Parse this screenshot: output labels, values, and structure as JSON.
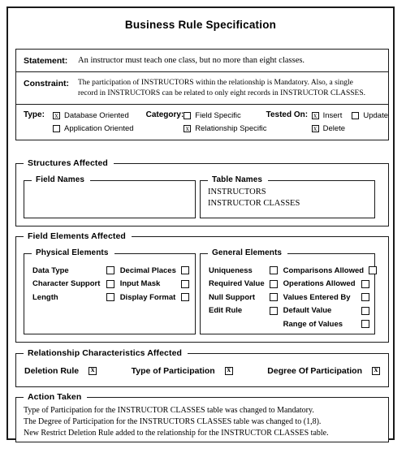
{
  "document": {
    "title": "Business Rule Specification"
  },
  "header": {
    "statement": {
      "label": "Statement:",
      "text": "An instructor must teach one class, but no more than eight classes."
    },
    "constraint": {
      "label": "Constraint:",
      "line1": "The participation of INSTRUCTORS within the relationship is Mandatory. Also, a single",
      "line2": "record in INSTRUCTORS can be related to only eight records in INSTRUCTOR CLASSES."
    }
  },
  "classification": {
    "type": {
      "label": "Type:",
      "options": [
        {
          "label": "Database Oriented",
          "checked": true
        },
        {
          "label": "Application Oriented",
          "checked": false
        }
      ]
    },
    "category": {
      "label": "Category:",
      "options": [
        {
          "label": "Field Specific",
          "checked": false
        },
        {
          "label": "Relationship Specific",
          "checked": true
        }
      ]
    },
    "tested_on": {
      "label": "Tested On:",
      "options": [
        {
          "label": "Insert",
          "checked": true
        },
        {
          "label": "Update",
          "checked": false
        },
        {
          "label": "Delete",
          "checked": true
        }
      ]
    }
  },
  "structures_affected": {
    "legend": "Structures Affected",
    "field_names": {
      "legend": "Field Names",
      "items": []
    },
    "table_names": {
      "legend": "Table Names",
      "items": [
        "INSTRUCTORS",
        "INSTRUCTOR CLASSES"
      ]
    }
  },
  "field_elements_affected": {
    "legend": "Field Elements Affected",
    "physical_elements": {
      "legend": "Physical Elements",
      "column1": [
        {
          "label": "Data Type",
          "checked": false
        },
        {
          "label": "Character Support",
          "checked": false
        },
        {
          "label": "Length",
          "checked": false
        }
      ],
      "column2": [
        {
          "label": "Decimal Places",
          "checked": false
        },
        {
          "label": "Input Mask",
          "checked": false
        },
        {
          "label": "Display Format",
          "checked": false
        }
      ]
    },
    "general_elements": {
      "legend": "General Elements",
      "column1": [
        {
          "label": "Uniqueness",
          "checked": false
        },
        {
          "label": "Required Value",
          "checked": false
        },
        {
          "label": "Null Support",
          "checked": false
        },
        {
          "label": "Edit Rule",
          "checked": false
        }
      ],
      "column2": [
        {
          "label": "Comparisons Allowed",
          "checked": false
        },
        {
          "label": "Operations Allowed",
          "checked": false
        },
        {
          "label": "Values Entered By",
          "checked": false
        },
        {
          "label": "Default Value",
          "checked": false
        },
        {
          "label": "Range of Values",
          "checked": false
        }
      ]
    }
  },
  "relationship_characteristics_affected": {
    "legend": "Relationship Characteristics Affected",
    "items": [
      {
        "label": "Deletion Rule",
        "checked": true
      },
      {
        "label": "Type of Participation",
        "checked": true
      },
      {
        "label": "Degree Of Participation",
        "checked": true
      }
    ]
  },
  "action_taken": {
    "legend": "Action Taken",
    "lines": [
      "Type of Participation for the INSTRUCTOR CLASSES table was changed to Mandatory.",
      "The Degree of Participation for the INSTRUCTORS CLASSES table was changed to (1,8).",
      "New Restrict Deletion Rule added to the relationship for the INSTRUCTOR CLASSES table."
    ]
  },
  "colors": {
    "border": "#1a1a1a",
    "background": "#ffffff",
    "text": "#000000"
  }
}
